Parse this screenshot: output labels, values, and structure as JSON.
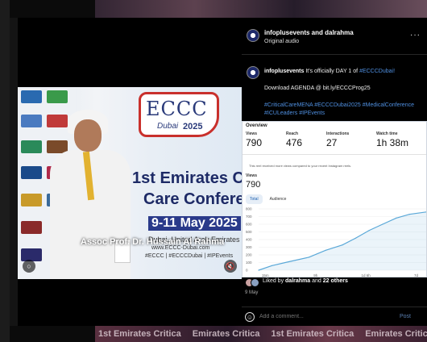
{
  "background": {
    "ticker": [
      "1st Emirates Critica",
      "Emirates Critica",
      "1st Emirates Critica",
      "Emirates Critica"
    ]
  },
  "post": {
    "header": {
      "names": "infoplusevents and dalrahma",
      "audio": "Original audio",
      "more_icon": "more-horizontal-icon"
    },
    "author": "infoplusevents",
    "caption_text": "It's officially DAY 1 of ",
    "caption_tag": "#ECCCDubai!",
    "agenda": "Download AGENDA @ bit.ly/ECCCProg25",
    "hashtags": "#CriticalCareMENA #ECCCDubai2025 #MedicalConference #ICULeaders #IPEvents",
    "likes_prefix": "Liked by ",
    "likes_user": "dalrahma",
    "likes_mid": " and ",
    "likes_count": "22 others",
    "date": "9 May",
    "comment_placeholder": "Add a comment...",
    "post_button": "Post"
  },
  "video": {
    "logo_big": "ECCC",
    "logo_city": "Dubai",
    "logo_year": "2025",
    "poster_line1": "1st Emirates Critic",
    "poster_line2": "Care Conferen",
    "poster_dates": "9-11 May 2025",
    "poster_place": "Dubai, United Arab Emirates",
    "poster_site": "www.ECCC-Dubai.com",
    "poster_tags": "#ECCC | #ECCCDubai | #IPEvents",
    "speaker_caption": "Assoc Prof. Dr. Hussain Al Rahma"
  },
  "insights": {
    "title": "Overview",
    "metrics": [
      {
        "label": "Views",
        "value": "790"
      },
      {
        "label": "Reach",
        "value": "476"
      },
      {
        "label": "Interactions",
        "value": "27"
      },
      {
        "label": "Watch time",
        "value": "1h 38m"
      }
    ],
    "note": "This reel received more views compared to your recent Instagram reels.",
    "views_label": "Views",
    "views_value": "790",
    "tabs": [
      "Total",
      "Audience"
    ],
    "accent": "#5aa8d8"
  },
  "chart_data": {
    "type": "area",
    "title": "",
    "xlabel": "",
    "ylabel": "",
    "x_ticks": [
      "15m",
      "9h",
      "1d 6h",
      "7d"
    ],
    "y_ticks": [
      0,
      100,
      200,
      300,
      400,
      500,
      600,
      700,
      800
    ],
    "ylim": [
      0,
      800
    ],
    "x": [
      0,
      0.08,
      0.18,
      0.3,
      0.4,
      0.5,
      0.58,
      0.66,
      0.74,
      0.82,
      0.9,
      1.0
    ],
    "values": [
      0,
      60,
      110,
      170,
      260,
      330,
      420,
      520,
      600,
      680,
      730,
      760
    ]
  }
}
